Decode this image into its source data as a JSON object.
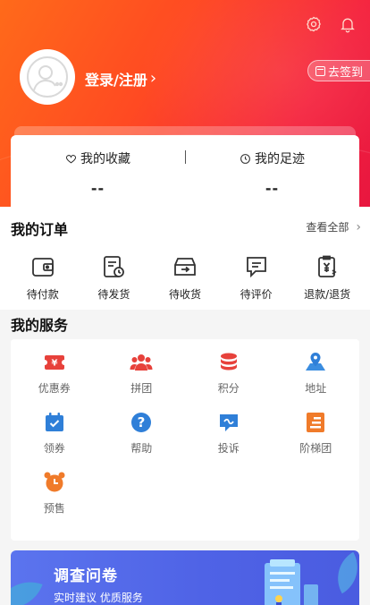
{
  "header": {
    "login_label": "登录/注册",
    "checkin_label": "去签到",
    "colors": {
      "start": "#ff6a1a",
      "end": "#e8163f"
    }
  },
  "stats": {
    "favorites": {
      "label": "我的收藏",
      "value": "--"
    },
    "footprints": {
      "label": "我的足迹",
      "value": "--"
    }
  },
  "orders": {
    "title": "我的订单",
    "view_all": "查看全部",
    "items": [
      {
        "label": "待付款",
        "icon": "wallet-icon"
      },
      {
        "label": "待发货",
        "icon": "clipboard-clock-icon"
      },
      {
        "label": "待收货",
        "icon": "inbox-arrow-icon"
      },
      {
        "label": "待评价",
        "icon": "chat-lines-icon"
      },
      {
        "label": "退款/退货",
        "icon": "refund-icon"
      }
    ]
  },
  "services": {
    "title": "我的服务",
    "items": [
      {
        "label": "优惠券",
        "icon": "coupon-icon"
      },
      {
        "label": "拼团",
        "icon": "group-icon"
      },
      {
        "label": "积分",
        "icon": "coins-icon"
      },
      {
        "label": "地址",
        "icon": "map-pin-icon"
      },
      {
        "label": "领券",
        "icon": "calendar-check-icon"
      },
      {
        "label": "帮助",
        "icon": "help-icon"
      },
      {
        "label": "投诉",
        "icon": "complaint-icon"
      },
      {
        "label": "阶梯团",
        "icon": "ladder-icon"
      },
      {
        "label": "预售",
        "icon": "alarm-clock-icon"
      }
    ]
  },
  "survey": {
    "title": "调查问卷",
    "subtitle": "实时建议  优质服务"
  }
}
